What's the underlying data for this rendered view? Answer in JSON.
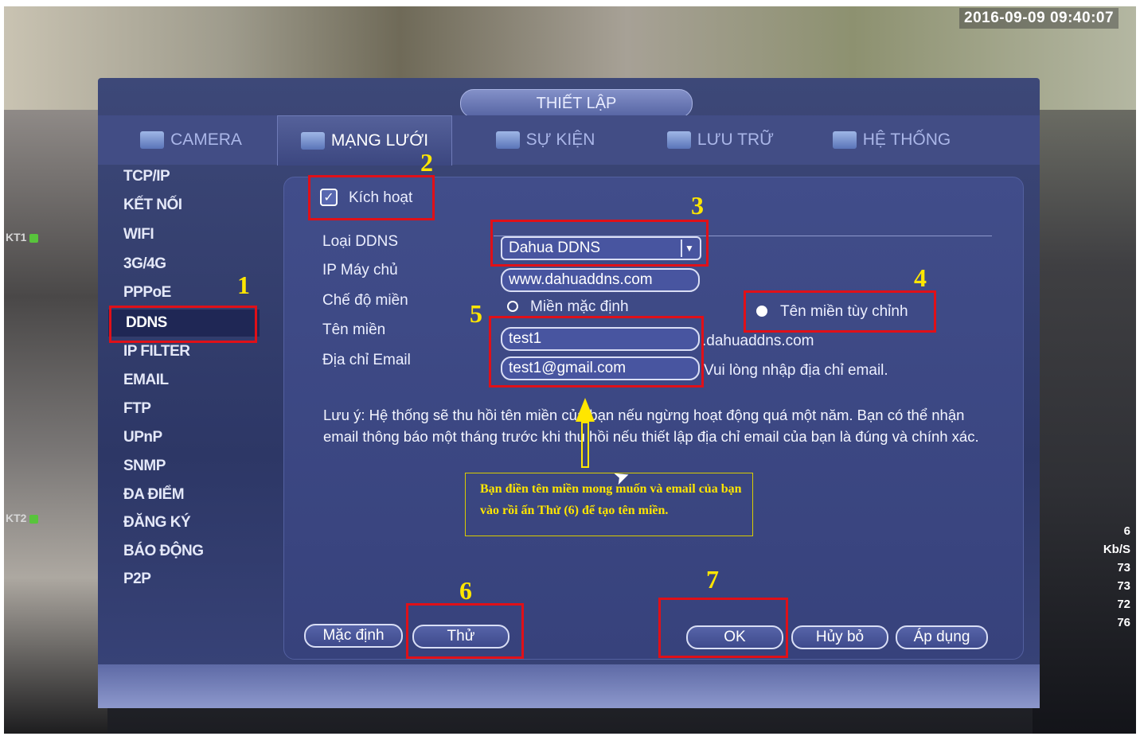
{
  "timestamp": "2016-09-09 09:40:07",
  "cams": {
    "left1": "KT1",
    "left2": "KT2"
  },
  "stats": {
    "count": "6",
    "unit": "Kb/S",
    "values": [
      "73",
      "73",
      "72",
      "76"
    ]
  },
  "dialog_title": "THIẾT LẬP",
  "tabs": [
    {
      "label": "CAMERA",
      "icon": "camera-icon"
    },
    {
      "label": "MẠNG LƯỚI",
      "icon": "network-icon"
    },
    {
      "label": "SỰ KIỆN",
      "icon": "event-icon"
    },
    {
      "label": "LƯU TRỮ",
      "icon": "storage-icon"
    },
    {
      "label": "HỆ THỐNG",
      "icon": "system-icon"
    }
  ],
  "active_tab": "MẠNG LƯỚI",
  "sidebar": [
    "TCP/IP",
    "KẾT NỐI",
    "WIFI",
    "3G/4G",
    "PPPoE",
    "DDNS",
    "IP FILTER",
    "EMAIL",
    "FTP",
    "UPnP",
    "SNMP",
    "ĐA ĐIỂM",
    "ĐĂNG KÝ",
    "BÁO ĐỘNG",
    "P2P"
  ],
  "active_sidebar": "DDNS",
  "form": {
    "enable_label": "Kích hoạt",
    "enable_checked": true,
    "ddns_type_label": "Loại DDNS",
    "ddns_type_value": "Dahua DDNS",
    "server_ip_label": "IP Máy chủ",
    "server_ip_value": "www.dahuaddns.com",
    "domain_mode_label": "Chế độ miền",
    "mode_default": "Miền mặc định",
    "mode_custom": "Tên miền tùy chỉnh",
    "mode_selected": "Tên miền tùy chỉnh",
    "domain_label": "Tên miền",
    "domain_value": "test1",
    "domain_suffix": ".dahuaddns.com",
    "email_label": "Địa chỉ Email",
    "email_value": "test1@gmail.com",
    "email_hint": "Vui lòng nhập địa chỉ email."
  },
  "note": "Lưu ý: Hệ thống sẽ thu hồi tên miền của bạn nếu ngừng hoạt động quá một năm. Bạn có thể nhận email thông báo một tháng trước khi thu hồi nếu thiết lập địa chỉ email của bạn là đúng và chính xác.",
  "callout": "Bạn điền tên miền mong muốn và email của bạn vào rồi ấn Thử (6) để tạo tên miền.",
  "buttons": {
    "default": "Mặc định",
    "test": "Thử",
    "ok": "OK",
    "cancel": "Hủy bỏ",
    "apply": "Áp dụng"
  },
  "step_numbers": [
    "1",
    "2",
    "3",
    "4",
    "5",
    "6",
    "7"
  ],
  "annotation_color": "#e01018",
  "step_number_color": "#ffe600"
}
